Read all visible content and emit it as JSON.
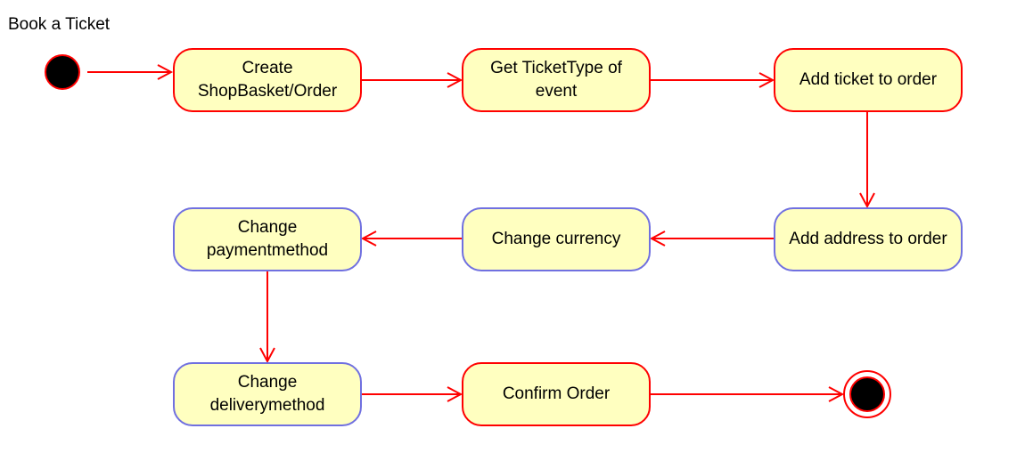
{
  "title": "Book a Ticket",
  "colors": {
    "transition": "#ff0000",
    "action_fill": "#ffffc0",
    "action_border_red": "#ff0000",
    "action_border_blue": "#7070e0",
    "initial_fill": "#000000"
  },
  "nodes": [
    {
      "id": "create",
      "lines": [
        "Create",
        "ShopBasket/Order"
      ]
    },
    {
      "id": "gettype",
      "lines": [
        "Get TicketType of",
        "event"
      ]
    },
    {
      "id": "addticket",
      "lines": [
        "Add ticket to order"
      ]
    },
    {
      "id": "addaddress",
      "lines": [
        "Add address to order"
      ]
    },
    {
      "id": "currency",
      "lines": [
        "Change currency"
      ]
    },
    {
      "id": "payment",
      "lines": [
        "Change",
        "paymentmethod"
      ]
    },
    {
      "id": "delivery",
      "lines": [
        "Change",
        "deliverymethod"
      ]
    },
    {
      "id": "confirm",
      "lines": [
        "Confirm Order"
      ]
    }
  ],
  "edges": [
    [
      "initial",
      "create"
    ],
    [
      "create",
      "gettype"
    ],
    [
      "gettype",
      "addticket"
    ],
    [
      "addticket",
      "addaddress"
    ],
    [
      "addaddress",
      "currency"
    ],
    [
      "currency",
      "payment"
    ],
    [
      "payment",
      "delivery"
    ],
    [
      "delivery",
      "confirm"
    ],
    [
      "confirm",
      "final"
    ]
  ]
}
